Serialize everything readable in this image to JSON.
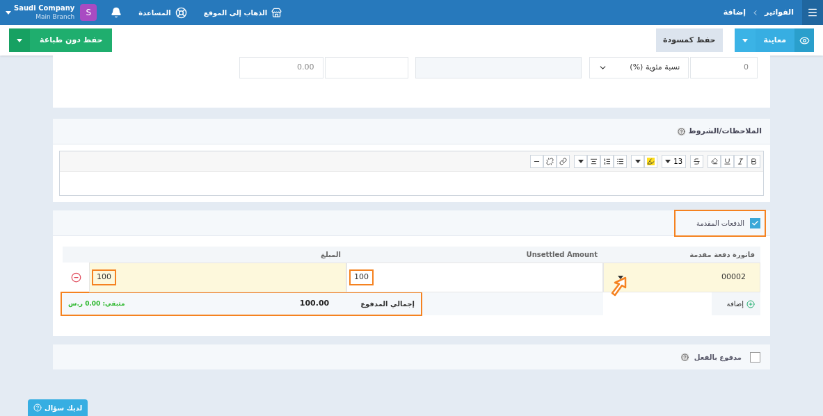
{
  "header": {
    "breadcrumb": [
      "الفواتير",
      "إضافة"
    ],
    "links": [
      {
        "kind": "store",
        "label": "الذهاب إلى الموقع"
      },
      {
        "kind": "help",
        "label": "المساعدة"
      }
    ],
    "avatar": "S",
    "company": "Saudi Company",
    "branch": "Main Branch"
  },
  "toolbar": {
    "preview": "معاينة",
    "draft": "حفظ كمسودة",
    "save": "حفظ دون طباعة"
  },
  "discount_row": {
    "value": "0",
    "type": "نسبة مئوية (%)",
    "amount": "0.00"
  },
  "notes": {
    "title": "الملاحظات/الشروط",
    "font_size": "13"
  },
  "advance": {
    "label": "الدفعات المقدمة",
    "checked": true,
    "highlighted": true,
    "columns": [
      "فاتورة دفعة مقدمة",
      "Unsettled Amount",
      "المبلغ"
    ],
    "rows": [
      {
        "invoice": "00002",
        "unsettled": "100",
        "amount": "100",
        "highlighted": true
      }
    ],
    "add": "إضافة",
    "total_label": "إجمالي المدفوع",
    "total": "100.00",
    "remaining": "متبقي: 0.00 ر.س",
    "total_highlighted": true
  },
  "paid": {
    "label": "مدفوع بالفعل",
    "checked": false
  },
  "help_button": "لديك سؤال"
}
